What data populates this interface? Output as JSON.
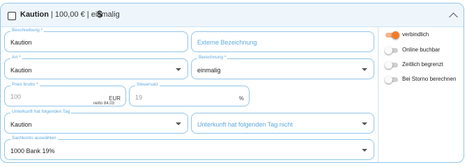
{
  "header": {
    "title": "Kaution",
    "summary": "| 100,00 € | einmalig",
    "currency_icon": "$"
  },
  "fields": {
    "beschreibung": {
      "label": "Beschreibung *",
      "value": "Kaution"
    },
    "externe_bezeichnung": {
      "placeholder": "Externe Bezeichnung"
    },
    "art": {
      "label": "Art *",
      "value": "Kaution"
    },
    "berechnung": {
      "label": "Berechnung *",
      "value": "einmalig"
    },
    "preis_brutto": {
      "label": "Preis brutto *",
      "value": "100",
      "suffix": "EUR",
      "netto": "netto 84.03"
    },
    "steuersatz": {
      "label": "Steuersatz",
      "value": "19",
      "suffix": "%"
    },
    "unterkunft_tag": {
      "label": "Unterkunft hat folgenden Tag",
      "value": "Kaution"
    },
    "unterkunft_tag_nicht": {
      "placeholder": "Unterkunft hat folgenden Tag nicht"
    },
    "sachkonto": {
      "label": "Sachkonto auswählen",
      "value": "1000 Bank 19%"
    }
  },
  "toggles": [
    {
      "label": "verbindlich",
      "on": true
    },
    {
      "label": "Online buchbar",
      "on": false
    },
    {
      "label": "Zeitlich begrenzt",
      "on": false
    },
    {
      "label": "Bei Storno berechnen",
      "on": false
    }
  ],
  "colors": {
    "accent": "#f37b2c",
    "border": "#90c4e8",
    "label": "#5da9de"
  }
}
